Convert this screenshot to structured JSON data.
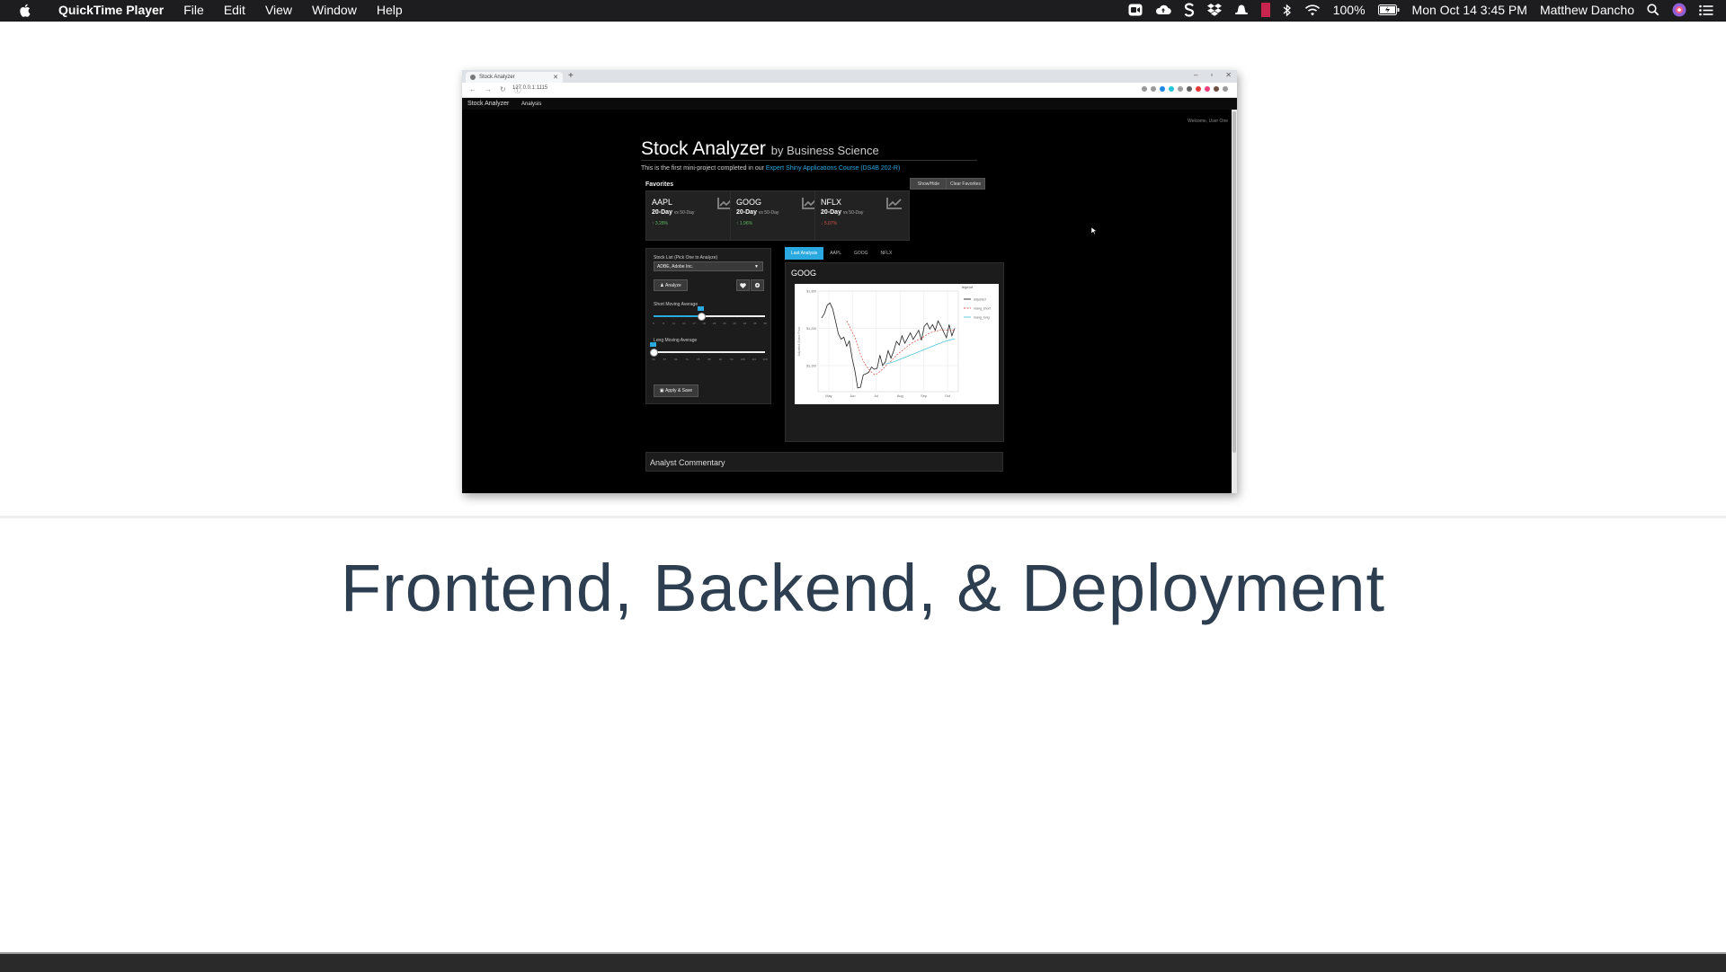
{
  "menubar": {
    "app_name": "QuickTime Player",
    "menus": [
      "File",
      "Edit",
      "View",
      "Window",
      "Help"
    ],
    "battery": "100%",
    "datetime": "Mon Oct 14  3:45 PM",
    "user": "Matthew Dancho"
  },
  "browser": {
    "tab_title": "Stock Analyzer",
    "url": "127.0.0.1:1115"
  },
  "app": {
    "brand": "Stock Analyzer",
    "nav_link": "Analysis",
    "welcome": "Welcome, User One",
    "title": "Stock Analyzer",
    "title_by": "by Business Science",
    "intro_text": "This is the first mini-project completed in our",
    "intro_link": "Expert Shiny Applications Course (DS4B 202-R)",
    "favorites_label": "Favorites",
    "show_hide_label": "Show/Hide",
    "clear_favorites_label": "Clear Favorites",
    "favorites": [
      {
        "symbol": "AAPL",
        "period": "20-Day",
        "vs": "vs 50-Day",
        "change": "↑ 3.28%",
        "up": true
      },
      {
        "symbol": "GOOG",
        "period": "20-Day",
        "vs": "vs 50-Day",
        "change": "↑ 1.96%",
        "up": true
      },
      {
        "symbol": "NFLX",
        "period": "20-Day",
        "vs": "vs 50-Day",
        "change": "↓ 5.07%",
        "up": false
      }
    ],
    "stock_list_label": "Stock List (Pick One to Analyze)",
    "stock_selected": "ADBE, Adobe Inc.",
    "analyze_label": "Analyze",
    "short_ma_label": "Short Moving Average",
    "short_ma_value": 20,
    "short_ma_range": [
      5,
      40
    ],
    "short_ma_ticks": [
      "5",
      "8",
      "11",
      "14",
      "17",
      "20",
      "23",
      "26",
      "29",
      "32",
      "35",
      "38"
    ],
    "long_ma_label": "Long Moving Average",
    "long_ma_value": 50,
    "long_ma_range": [
      50,
      120
    ],
    "long_ma_ticks": [
      "50",
      "57",
      "64",
      "71",
      "78",
      "85",
      "92",
      "99",
      "106",
      "113",
      "120"
    ],
    "apply_label": "Apply & Save",
    "tabs": [
      "Last Analysis",
      "AAPL",
      "GOOG",
      "NFLX"
    ],
    "active_tab": 0,
    "chart_ticker": "GOOG",
    "commentary_label": "Analyst Commentary"
  },
  "headline": "Frontend, Backend, & Deployment",
  "colors": {
    "accent": "#2aa8e0",
    "headline": "#2c3e50",
    "up": "#5cb85c",
    "down": "#d9534f",
    "adjusted_line": "#222222",
    "short_line": "#e05a5a",
    "long_line": "#4fc3d9"
  },
  "chart_data": {
    "type": "line",
    "title": "",
    "xlabel": "",
    "ylabel": "Adjusted Share Price",
    "x_ticks": [
      "May",
      "Jun",
      "Jul",
      "Aug",
      "Sep",
      "Oct"
    ],
    "y_ticks": [
      "$1,100",
      "$1,200",
      "$1,300"
    ],
    "ylim": [
      1030,
      1300
    ],
    "legend_title": "legend",
    "series": [
      {
        "name": "adjusted",
        "values": [
          1228,
          1240,
          1262,
          1268,
          1252,
          1220,
          1186,
          1171,
          1176,
          1152,
          1166,
          1120,
          1086,
          1040,
          1042,
          1075,
          1078,
          1082,
          1096,
          1090,
          1093,
          1128,
          1100,
          1110,
          1140,
          1120,
          1140,
          1165,
          1155,
          1180,
          1160,
          1174,
          1188,
          1170,
          1182,
          1195,
          1168,
          1205,
          1214,
          1198,
          1210,
          1195,
          1220,
          1206,
          1190,
          1175,
          1210,
          1180,
          1200
        ]
      },
      {
        "name": "mavg_short",
        "values": [
          null,
          null,
          null,
          null,
          null,
          null,
          null,
          null,
          null,
          1220,
          1206,
          1190,
          1176,
          1154,
          1130,
          1112,
          1100,
          1090,
          1082,
          1076,
          1078,
          1084,
          1090,
          1098,
          1106,
          1112,
          1120,
          1128,
          1134,
          1140,
          1146,
          1152,
          1158,
          1162,
          1166,
          1170,
          1174,
          1178,
          1183,
          1188,
          1190,
          1192,
          1194,
          1196,
          1196,
          1195,
          1196,
          1195,
          1196
        ]
      },
      {
        "name": "mavg_long",
        "values": [
          null,
          null,
          null,
          null,
          null,
          null,
          null,
          null,
          null,
          null,
          null,
          null,
          null,
          null,
          null,
          null,
          null,
          null,
          null,
          null,
          null,
          null,
          null,
          1104,
          1106,
          1108,
          1110,
          1113,
          1116,
          1119,
          1122,
          1125,
          1128,
          1131,
          1134,
          1137,
          1140,
          1143,
          1146,
          1149,
          1152,
          1155,
          1158,
          1161,
          1164,
          1166,
          1168,
          1170,
          1172
        ]
      }
    ]
  }
}
